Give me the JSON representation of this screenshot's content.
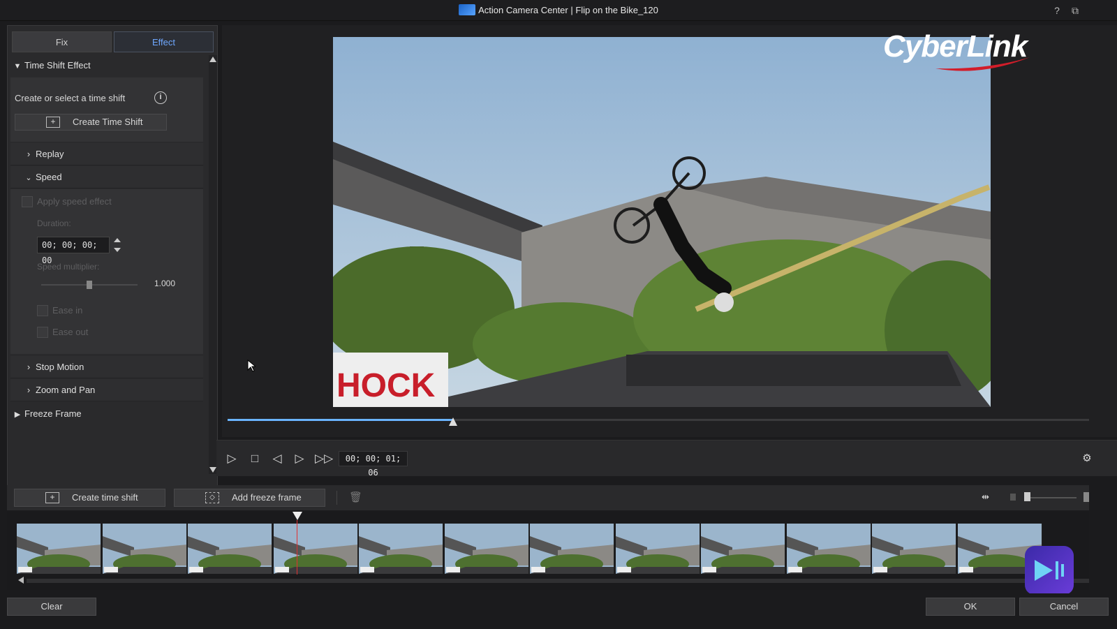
{
  "window": {
    "title": "Action Camera Center  |  Flip on the Bike_120",
    "help_label": "?",
    "restore_label": "⧉"
  },
  "tabs": {
    "fix": "Fix",
    "effect": "Effect"
  },
  "time_shift": {
    "header": "Time Shift Effect",
    "prompt": "Create or select a time shift",
    "create_button": "Create Time Shift",
    "sub_sections": {
      "replay": "Replay",
      "speed": "Speed",
      "stop_motion": "Stop Motion",
      "zoom_pan": "Zoom and Pan"
    },
    "speed": {
      "apply_label": "Apply speed effect",
      "duration_label": "Duration:",
      "duration_value": "00; 00; 00; 00",
      "multiplier_label": "Speed multiplier:",
      "multiplier_value": "1.000",
      "ease_in": "Ease in",
      "ease_out": "Ease out"
    }
  },
  "freeze_frame": {
    "header": "Freeze Frame"
  },
  "preview": {
    "brand": "CyberLink",
    "banner_text": "HOCK",
    "seek_progress": 0.262
  },
  "transport": {
    "timecode": "00; 00; 01; 06"
  },
  "timeline": {
    "create_time_shift": "Create time shift",
    "add_freeze_frame": "Add freeze frame",
    "frame_count": 12
  },
  "footer": {
    "clear": "Clear",
    "ok": "OK",
    "cancel": "Cancel"
  },
  "colors": {
    "accent": "#6ab4ff",
    "playhead": "#e03030"
  }
}
